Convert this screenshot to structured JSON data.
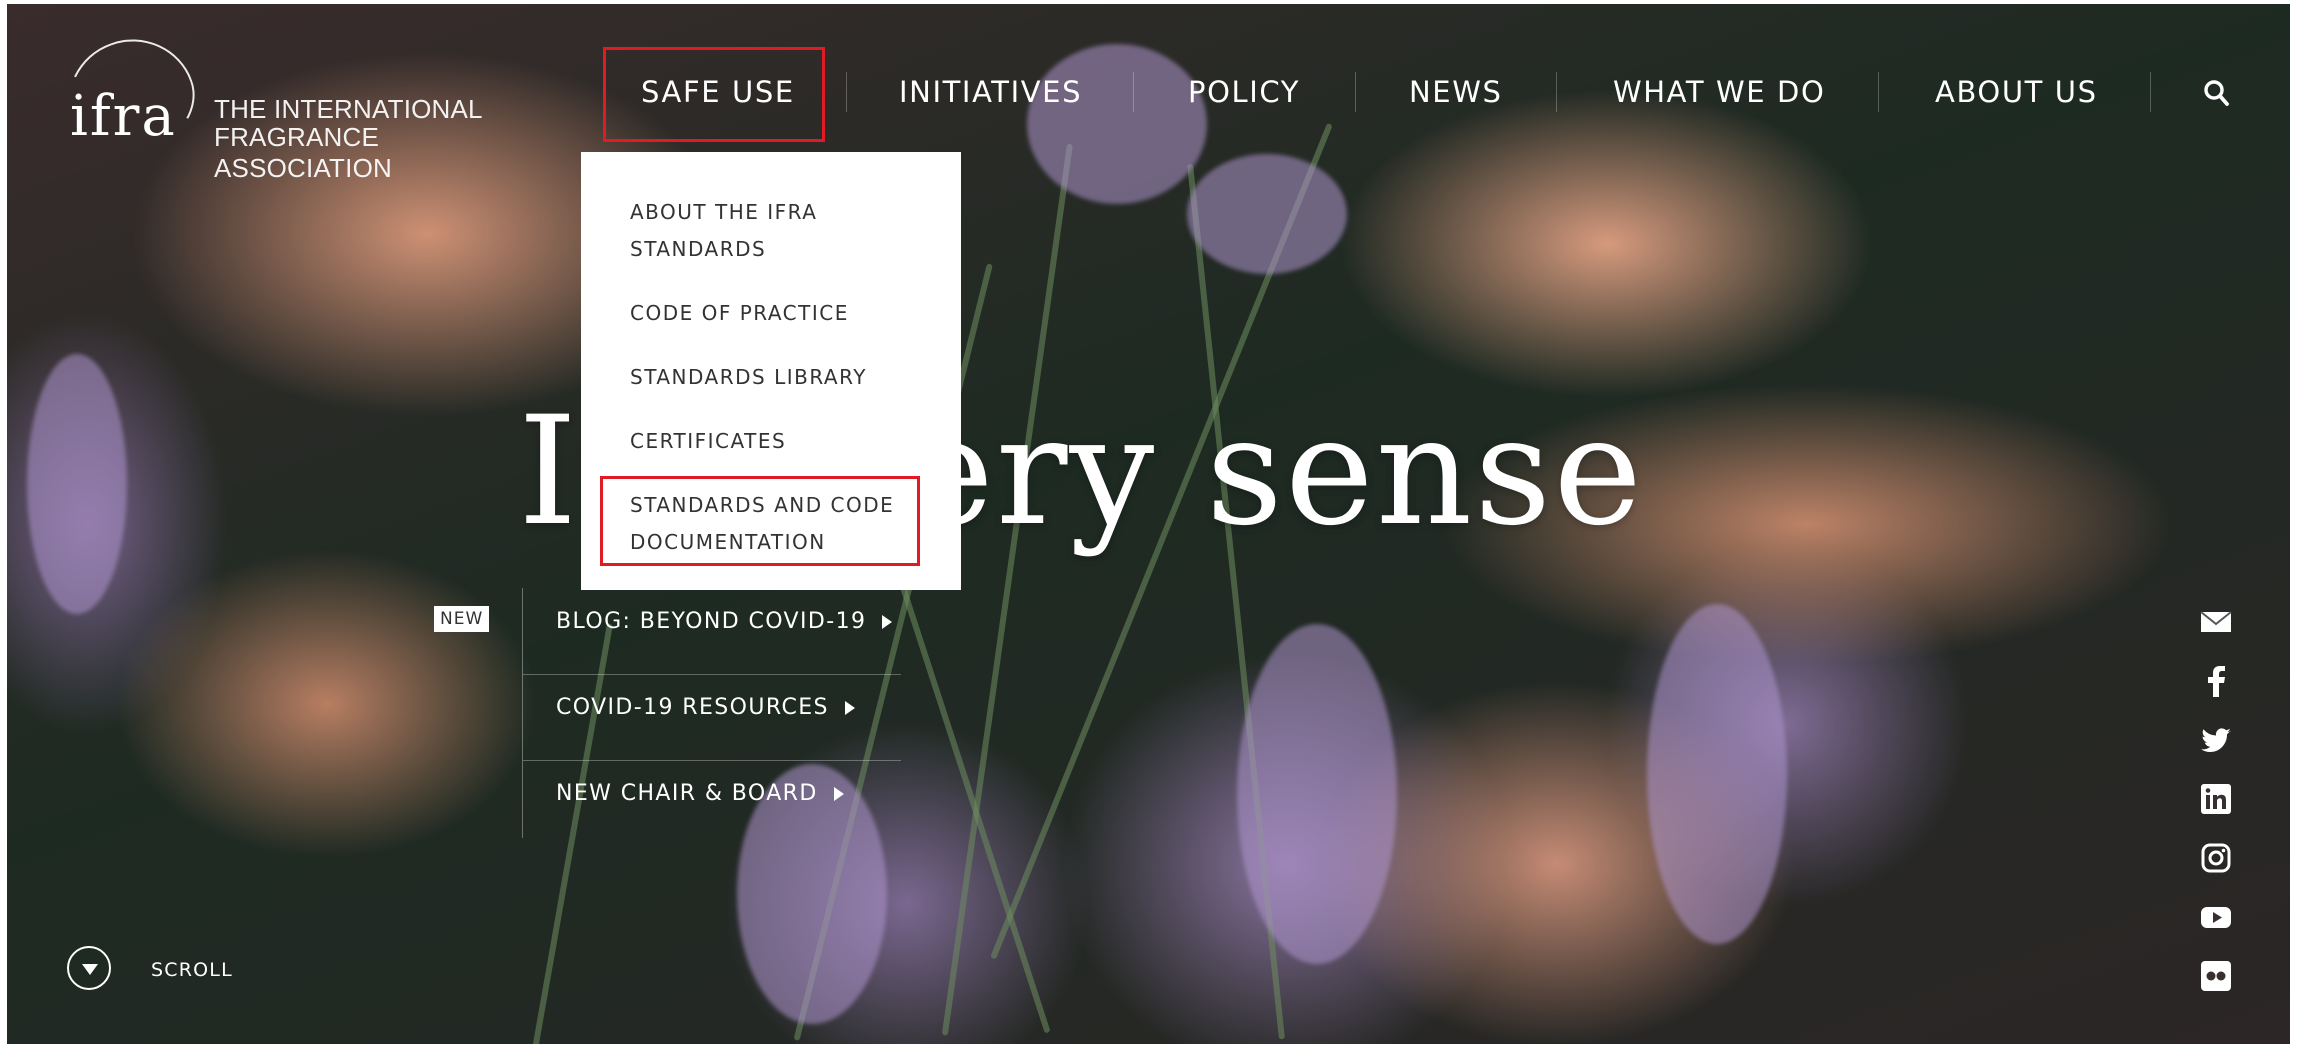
{
  "logo": {
    "mark": "ifra",
    "name_line1": "THE INTERNATIONAL",
    "name_line2": "FRAGRANCE ASSOCIATION"
  },
  "nav": {
    "items": [
      "SAFE USE",
      "INITIATIVES",
      "POLICY",
      "NEWS",
      "WHAT WE DO",
      "ABOUT US"
    ],
    "search_icon": "search-icon"
  },
  "dropdown": {
    "items": [
      {
        "line1": "ABOUT THE IFRA",
        "line2": "STANDARDS"
      },
      {
        "line1": "CODE OF PRACTICE"
      },
      {
        "line1": "STANDARDS LIBRARY"
      },
      {
        "line1": "CERTIFICATES"
      },
      {
        "line1": "STANDARDS AND CODE",
        "line2": "DOCUMENTATION"
      }
    ]
  },
  "hero": {
    "headline": "In every sense"
  },
  "news": {
    "badge": "NEW",
    "links": [
      "BLOG: BEYOND COVID-19",
      "COVID-19 RESOURCES",
      "NEW CHAIR & BOARD"
    ]
  },
  "scroll": {
    "label": "SCROLL"
  },
  "social": [
    "mail-icon",
    "facebook-icon",
    "twitter-icon",
    "linkedin-icon",
    "instagram-icon",
    "youtube-icon",
    "flickr-icon"
  ],
  "colors": {
    "highlight": "#e01b24",
    "dropdown_bg": "#ffffff",
    "dropdown_text": "#333333"
  }
}
